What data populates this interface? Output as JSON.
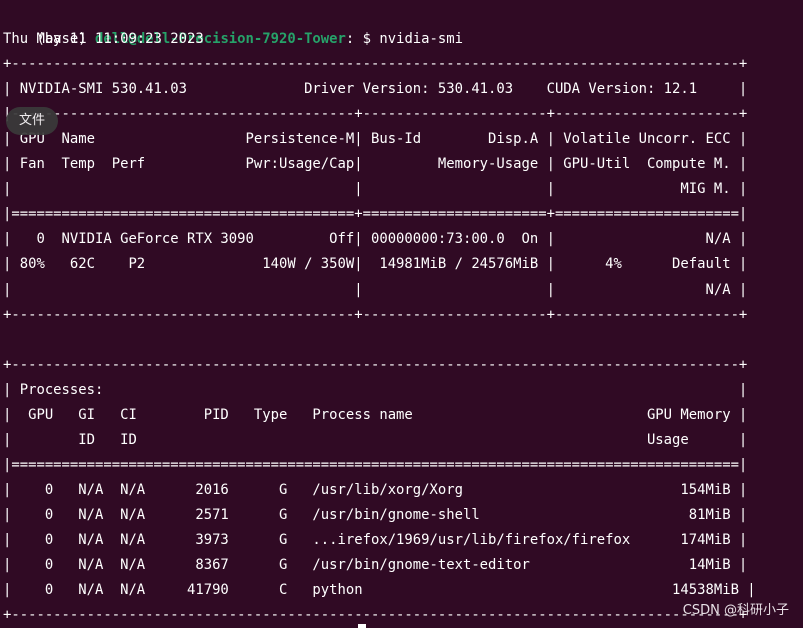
{
  "prompt": {
    "env": "(base) ",
    "user_host": "dell@dell-Precision-7920-Tower",
    "separator": ":",
    "symbol": " $ ",
    "command": "nvidia-smi"
  },
  "lines": [
    "Thu May 11 11:09:23 2023",
    "+---------------------------------------------------------------------------------------+",
    "| NVIDIA-SMI 530.41.03              Driver Version: 530.41.03    CUDA Version: 12.1     |",
    "|-----------------------------------------+----------------------+----------------------+",
    "| GPU  Name                  Persistence-M| Bus-Id        Disp.A | Volatile Uncorr. ECC |",
    "| Fan  Temp  Perf            Pwr:Usage/Cap|         Memory-Usage | GPU-Util  Compute M. |",
    "|                                         |                      |               MIG M. |",
    "|=========================================+======================+======================|",
    "|   0  NVIDIA GeForce RTX 3090         Off| 00000000:73:00.0  On |                  N/A |",
    "| 80%   62C    P2              140W / 350W|  14981MiB / 24576MiB |      4%      Default |",
    "|                                         |                      |                  N/A |",
    "+-----------------------------------------+----------------------+----------------------+",
    "",
    "+---------------------------------------------------------------------------------------+",
    "| Processes:                                                                            |",
    "|  GPU   GI   CI        PID   Type   Process name                            GPU Memory |",
    "|        ID   ID                                                             Usage      |",
    "|=======================================================================================|",
    "|    0   N/A  N/A      2016      G   /usr/lib/xorg/Xorg                          154MiB |",
    "|    0   N/A  N/A      2571      G   /usr/bin/gnome-shell                         81MiB |",
    "|    0   N/A  N/A      3973      G   ...irefox/1969/usr/lib/firefox/firefox      174MiB |",
    "|    0   N/A  N/A      8367      G   /usr/bin/gnome-text-editor                   14MiB |",
    "|    0   N/A  N/A     41790      C   python                                     14538MiB |",
    "+---------------------------------------------------------------------------------------+"
  ],
  "tooltip": "文件",
  "watermark": "CSDN @科研小子"
}
